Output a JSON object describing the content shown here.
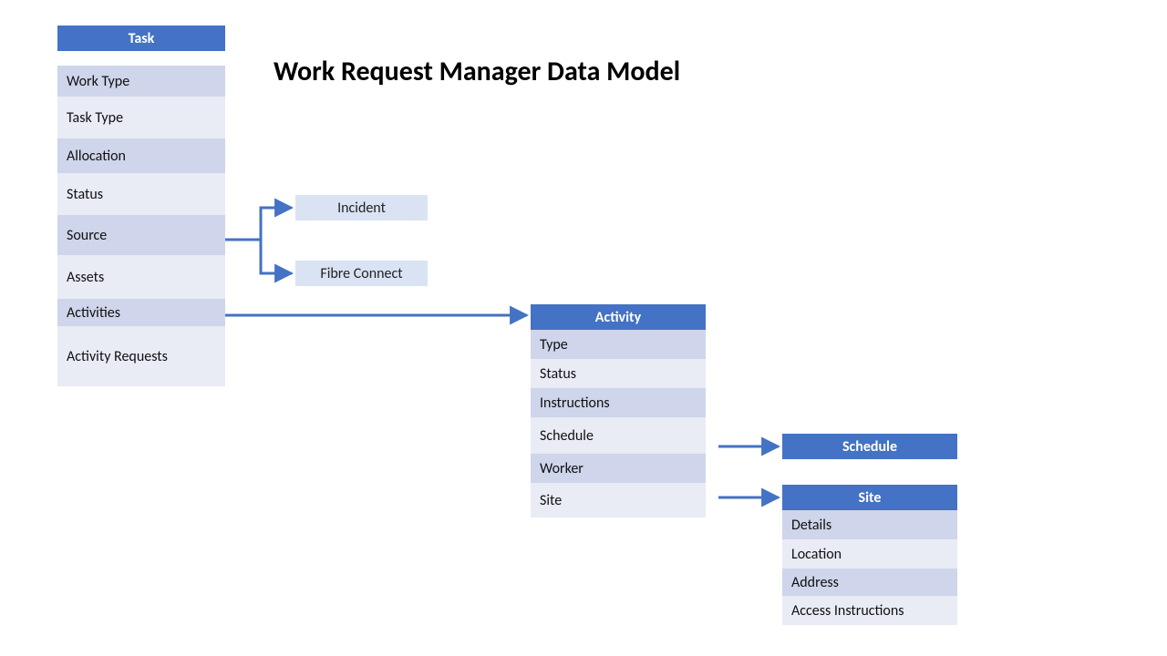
{
  "title": "Work Request Manager Data Model",
  "colors": {
    "header_bg": "#4472c4",
    "row_dark": "#cfd5ea",
    "row_light": "#e9ebf5",
    "chip_bg": "#dae3f3",
    "arrow": "#4472c4"
  },
  "task": {
    "header": "Task",
    "rows": [
      "Work Type",
      "Task Type",
      "Allocation",
      "Status",
      "Source",
      "Assets",
      "Activities",
      "Activity Requests"
    ]
  },
  "source_chips": {
    "incident": "Incident",
    "fibre": "Fibre Connect"
  },
  "activity": {
    "header": "Activity",
    "rows": [
      "Type",
      "Status",
      "Instructions",
      "Schedule",
      "Worker",
      "Site"
    ]
  },
  "schedule": {
    "header": "Schedule"
  },
  "site": {
    "header": "Site",
    "rows": [
      "Details",
      "Location",
      "Address",
      "Access Instructions"
    ]
  }
}
